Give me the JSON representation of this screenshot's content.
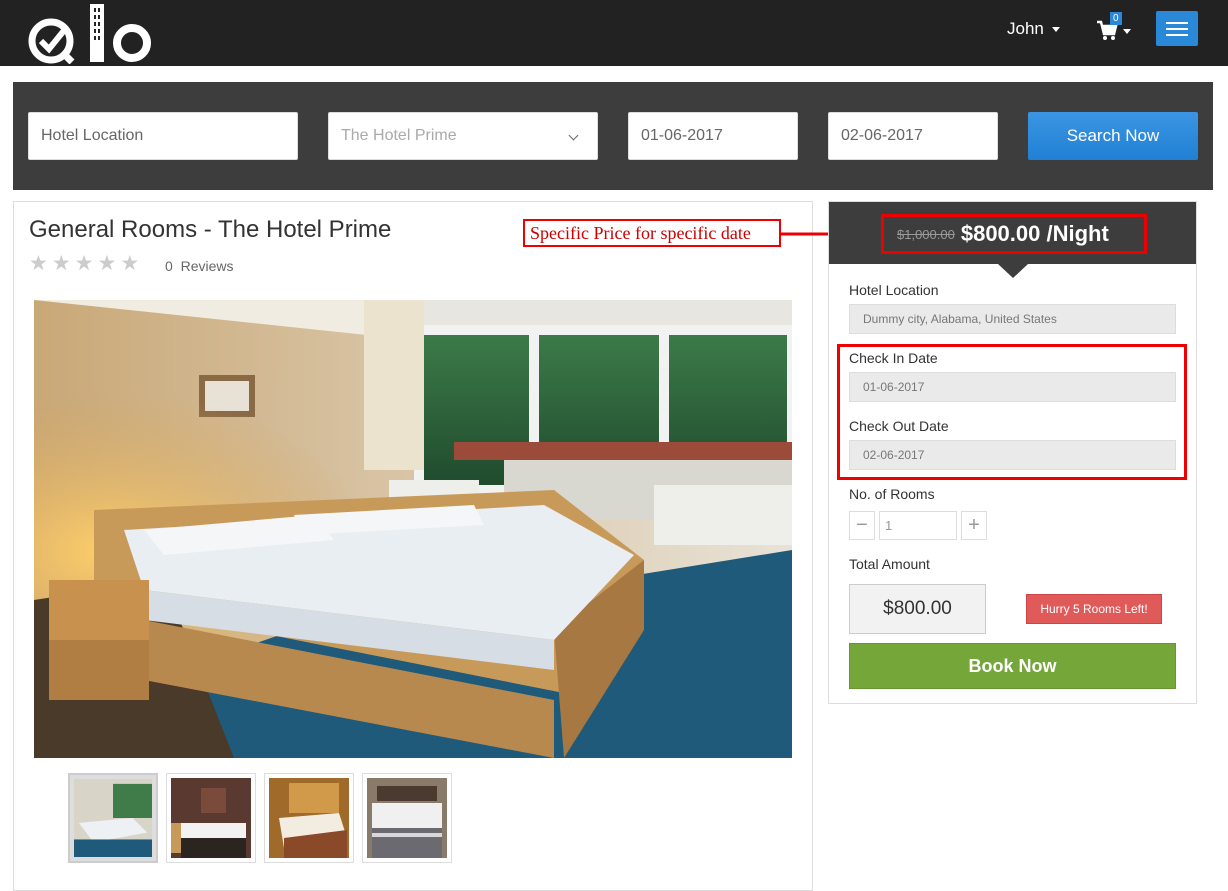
{
  "navbar": {
    "user_name": "John",
    "cart_count": "0"
  },
  "search": {
    "location_placeholder": "Hotel Location",
    "hotel_value": "The Hotel Prime",
    "checkin_value": "01-06-2017",
    "checkout_value": "02-06-2017",
    "button_label": "Search Now"
  },
  "room": {
    "title": "General Rooms - The Hotel Prime",
    "rating_stars": 0,
    "review_count": "0",
    "reviews_label": "Reviews"
  },
  "annotation": {
    "text": "Specific Price for specific date"
  },
  "booking": {
    "old_price": "$1,000.00",
    "new_price": "$800.00 /Night",
    "location_label": "Hotel Location",
    "location_value": "Dummy city, Alabama, United States",
    "checkin_label": "Check In Date",
    "checkin_value": "01-06-2017",
    "checkout_label": "Check Out Date",
    "checkout_value": "02-06-2017",
    "rooms_label": "No. of Rooms",
    "rooms_value": "1",
    "minus": "−",
    "plus": "+",
    "total_label": "Total Amount",
    "total_value": "$800.00",
    "hurry_text": "Hurry  5  Rooms Left!",
    "book_label": "Book Now"
  },
  "colors": {
    "accent_blue": "#2a88d8",
    "book_green": "#74a63a",
    "annotation_red": "#ee0000"
  }
}
